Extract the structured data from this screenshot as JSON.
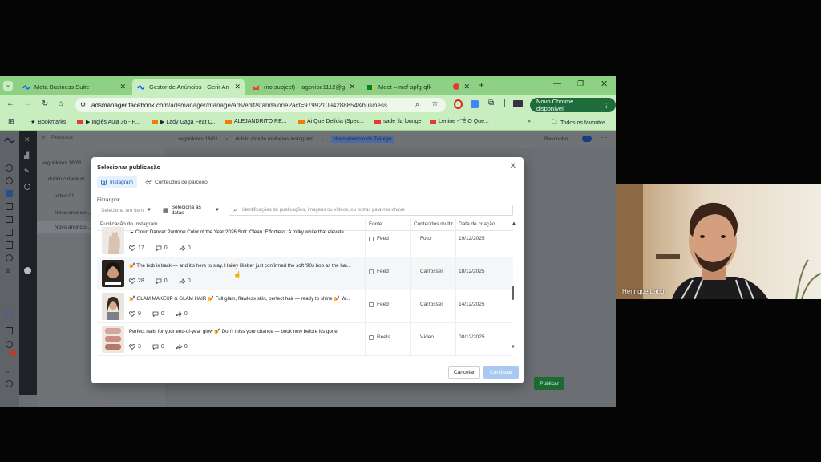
{
  "browser": {
    "tabs": [
      {
        "label": "Meta Business Suite",
        "active": false
      },
      {
        "label": "Gestor de Anúncios - Gerir Anú",
        "active": true
      },
      {
        "label": "(no subject) - lagovibe1112@g",
        "active": false
      },
      {
        "label": "Meet – mcf-spfg-qfk",
        "active": false
      }
    ],
    "url_host": "adsmanager.facebook.com",
    "url_path": "/adsmanager/manage/ads/edit/standalone?act=979921094288854&business...",
    "chrome_button": "Novo Chrome disponível",
    "bookmarks": [
      {
        "label": "Bookmarks",
        "icon": "star-icon"
      },
      {
        "label": "▶ Inglês Aula 36 - P...",
        "icon": "youtube-icon"
      },
      {
        "label": "▶ Lady Gaga Feat C...",
        "icon": "video-icon"
      },
      {
        "label": "ALEJANDRITO RE...",
        "icon": "video-icon"
      },
      {
        "label": "Ai Que Delícia (Spec...",
        "icon": "video-icon"
      },
      {
        "label": "sade ,la lounge",
        "icon": "youtube-icon"
      },
      {
        "label": "Lenine - \"É O Que...",
        "icon": "youtube-icon"
      }
    ],
    "all_bookmarks": "Todos os favoritos"
  },
  "page": {
    "search_placeholder": "Pesquisa",
    "tree": [
      "seguidores 16/01",
      "dublin cidade m...",
      "video 01",
      "Novo anúncio...",
      "Novo anúncio..."
    ],
    "breadcrumb": [
      "seguidores 16/01",
      "dublin cidade mulheres instagram",
      "Novo anúncio de Tráfego"
    ],
    "draft": "Rascunho",
    "publish": "Publicar"
  },
  "modal": {
    "title": "Selecionar publicação",
    "tabs": [
      "Instagram",
      "Conteúdos de parceiro"
    ],
    "filter_label": "Filtrar por:",
    "filter_item": "Seleciona um item",
    "filter_dates": "Seleciona as datas",
    "search_placeholder": "Identificações de publicações, imagens ou vídeos, ou outras palavras-chave",
    "columns": [
      "Publicação do Instagram",
      "Fonte",
      "Conteúdos multir",
      "Data de criação"
    ],
    "rows": [
      {
        "caption": "☁ Cloud Dancer Pantone Color of the Year 2026 Soft. Clean. Effortless. A milky white that elevate...",
        "likes": "17",
        "comments": "0",
        "shares": "0",
        "source": "Feed",
        "type": "Foto",
        "date": "19/12/2025"
      },
      {
        "caption": "💅 The bob is back — and it's here to stay. Hailey Bieber just confirmed the soft '90s bob as the hai...",
        "likes": "28",
        "comments": "0",
        "shares": "0",
        "source": "Feed",
        "type": "Carrossel",
        "date": "18/12/2025"
      },
      {
        "caption": "💅 GLAM MAKEUP & GLAM HAIR 💅 Full glam, flawless skin, perfect hair — ready to shine 💅 W...",
        "likes": "9",
        "comments": "0",
        "shares": "0",
        "source": "Feed",
        "type": "Carrossel",
        "date": "14/12/2025"
      },
      {
        "caption": "Perfect nails for your end-of-year glow 💅 Don't miss your chance — book now before it's gone!",
        "likes": "3",
        "comments": "0",
        "shares": "0",
        "source": "Reels",
        "type": "Vídeo",
        "date": "08/12/2025"
      }
    ],
    "cancel": "Cancelar",
    "continue": "Continuar"
  },
  "webcam": {
    "name": "Henrique Lago"
  },
  "colors": {
    "tab_bar": "#8fd184",
    "toolbar": "#c8eebf",
    "accent": "#1877f2",
    "publish": "#1d8f3a"
  }
}
